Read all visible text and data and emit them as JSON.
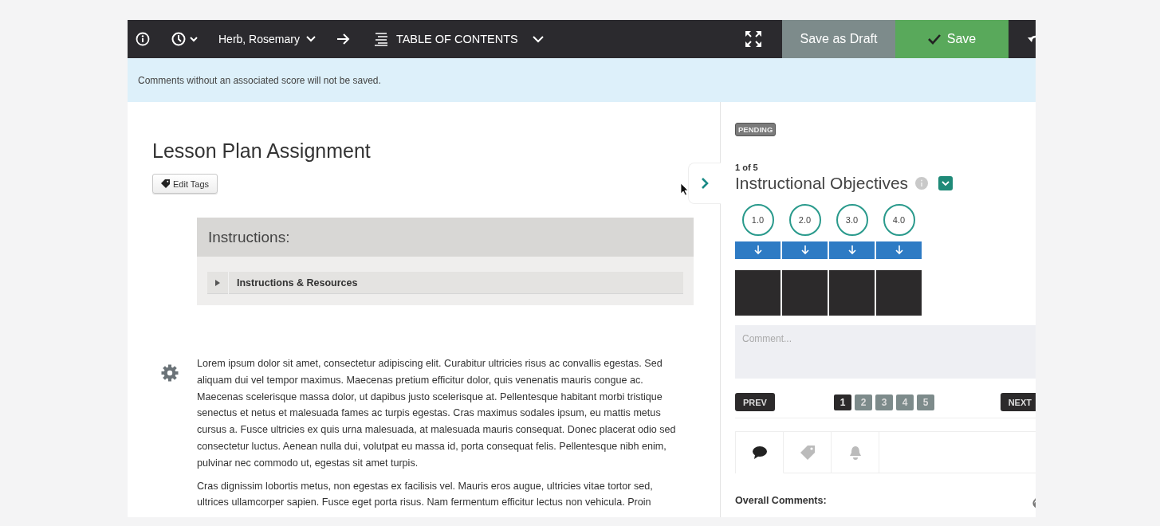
{
  "toolbar": {
    "user": "Herb, Rosemary",
    "contents": "TABLE OF CONTENTS",
    "draft_button": "Save as Draft",
    "save_button": "Save"
  },
  "notice": "Comments without an associated score will not be saved.",
  "assignment": {
    "title": "Lesson Plan Assignment",
    "edit_tags": "Edit Tags",
    "instructions": {
      "heading": "Instructions:",
      "item": "Instructions & Resources",
      "expanded": false
    },
    "paragraphs": [
      "Lorem ipsum dolor sit amet, consectetur adipiscing elit. Curabitur ultricies risus ac convallis egestas. Sed aliquam dui vel tempor maximus. Maecenas pretium efficitur dolor, quis venenatis mauris congue ac. Maecenas scelerisque massa dolor, ut dapibus justo scelerisque at. Pellentesque habitant morbi tristique senectus et netus et malesuada fames ac turpis egestas. Cras maximus sodales ipsum, eu mattis metus cursus a. Fusce ultricies ex quis urna malesuada, at malesuada mauris consequat. Donec placerat odio sed consectetur luctus. Aenean nulla dui, volutpat eu massa id, porta consequat felis. Pellentesque nibh enim, pulvinar nec commodo ut, egestas sit amet turpis.",
      "Cras dignissim lobortis metus, non egestas ex facilisis vel. Mauris eros augue, ultricies vitae tortor sed, ultrices ullamcorper sapien. Fusce eget porta risus. Nam fermentum efficitur lectus non vehicula. Proin"
    ]
  },
  "criterion": {
    "status": "PENDING",
    "position": "1 of 5",
    "title": "Instructional Objectives",
    "scores": [
      {
        "label": "1.0"
      },
      {
        "label": "2.0"
      },
      {
        "label": "3.0"
      },
      {
        "label": "4.0"
      }
    ],
    "comment_placeholder": "Comment...",
    "prev": "PREV",
    "next": "NEXT",
    "pages": [
      {
        "label": "1",
        "selected": true
      },
      {
        "label": "2",
        "selected": false
      },
      {
        "label": "3",
        "selected": false
      },
      {
        "label": "4",
        "selected": false
      },
      {
        "label": "5",
        "selected": false
      }
    ]
  },
  "tabs": [
    {
      "kind": "comment",
      "selected": true
    },
    {
      "kind": "tag",
      "selected": false
    },
    {
      "kind": "bell",
      "selected": false
    }
  ],
  "overall_comments": "Overall Comments:"
}
